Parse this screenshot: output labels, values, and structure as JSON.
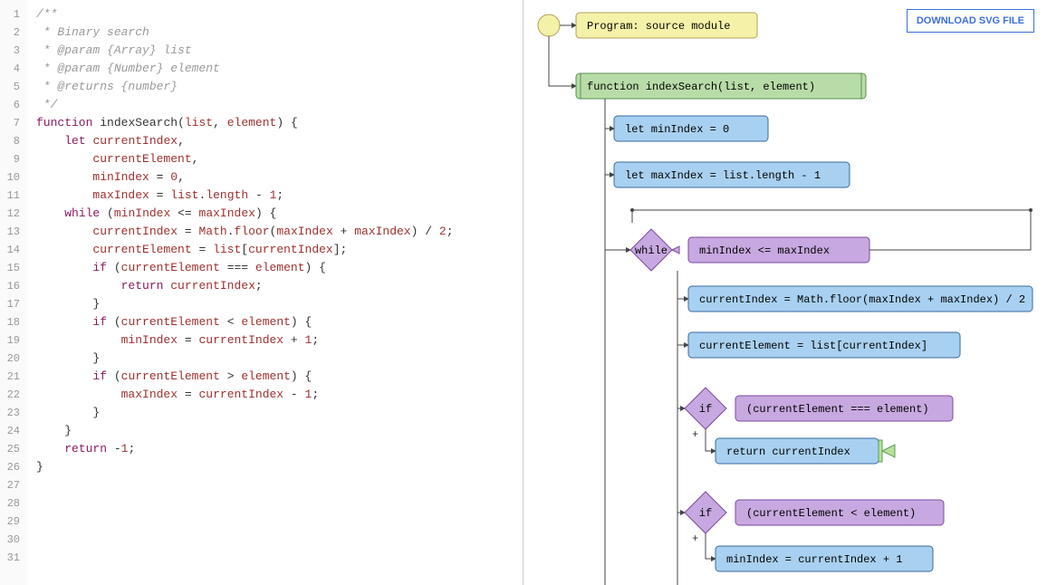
{
  "download_label": "DOWNLOAD SVG FILE",
  "code_lines": [
    "/**",
    " * Binary search",
    " * @param {Array} list",
    " * @param {Number} element",
    " * @returns {number}",
    " */",
    "function indexSearch(list, element) {",
    "    let currentIndex,",
    "        currentElement,",
    "        minIndex = 0,",
    "        maxIndex = list.length - 1;",
    "",
    "    while (minIndex <= maxIndex) {",
    "        currentIndex = Math.floor(maxIndex + maxIndex) / 2;",
    "        currentElement = list[currentIndex];",
    "",
    "        if (currentElement === element) {",
    "            return currentIndex;",
    "        }",
    "",
    "        if (currentElement < element) {",
    "            minIndex = currentIndex + 1;",
    "        }",
    "",
    "        if (currentElement > element) {",
    "            maxIndex = currentIndex - 1;",
    "        }",
    "    }",
    "",
    "    return -1;",
    "}"
  ],
  "code_highlight": {
    "comment_lines": [
      1,
      2,
      3,
      4,
      5,
      6
    ],
    "keywords": [
      "function",
      "let",
      "while",
      "if",
      "return"
    ],
    "vars": [
      "list",
      "element",
      "currentIndex",
      "currentElement",
      "minIndex",
      "maxIndex",
      "Math",
      "length",
      "floor"
    ]
  },
  "flow": {
    "program": "Program: source module",
    "fn": "function indexSearch(list, element)",
    "let1": "let minIndex = 0",
    "let2": "let maxIndex = list.length - 1",
    "while_kw": "while",
    "while_cond": "minIndex <= maxIndex",
    "s1": "currentIndex = Math.floor(maxIndex + maxIndex) / 2",
    "s2": "currentElement = list[currentIndex]",
    "if1_kw": "if",
    "if1_cond": "(currentElement === element)",
    "ret1": "return currentIndex",
    "if2_kw": "if",
    "if2_cond": "(currentElement < element)",
    "s3": "minIndex = currentIndex + 1",
    "plus": "+"
  },
  "colors": {
    "yellow": "#f4f2a8",
    "yellow_stroke": "#b0a058",
    "green": "#b8dca8",
    "green_stroke": "#5a9050",
    "blue": "#a8d0f0",
    "blue_stroke": "#3a6aa0",
    "purple": "#c8a8e0",
    "purple_stroke": "#7a4aa0"
  }
}
